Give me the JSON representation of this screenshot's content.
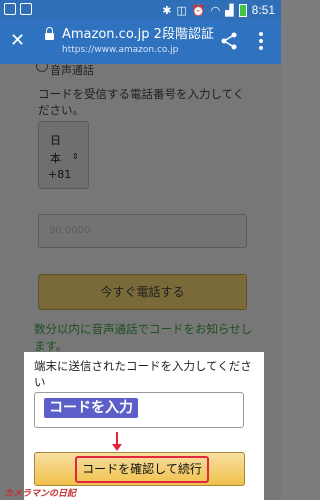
{
  "status_bar": {
    "time": "8:51"
  },
  "app_bar": {
    "title": "Amazon.co.jp 2段階認証",
    "url": "https://www.amazon.co.jp",
    "icons": [
      "close-icon",
      "lock-icon",
      "share-icon",
      "more-icon"
    ]
  },
  "page": {
    "radio_label": "音声通話",
    "phone_prompt": "コードを受信する電話番号を入力してください。",
    "country": {
      "line1": "日",
      "line2": "本",
      "code": "+81"
    },
    "phone_value": "90 0000",
    "call_button": "今すぐ電話する",
    "notice": "数分以内に音声通話でコードをお知らせします。"
  },
  "panel": {
    "instruction": "端末に送信されたコードを入力してください",
    "callout": "コードを入力",
    "confirm_button": "コードを確認して続行"
  },
  "watermark": "カメラマンの日記",
  "colors": {
    "app_bar": "#2f72bf",
    "highlight": "#e0273f",
    "callout": "#5b5fc7",
    "button": "#f0c14b"
  }
}
